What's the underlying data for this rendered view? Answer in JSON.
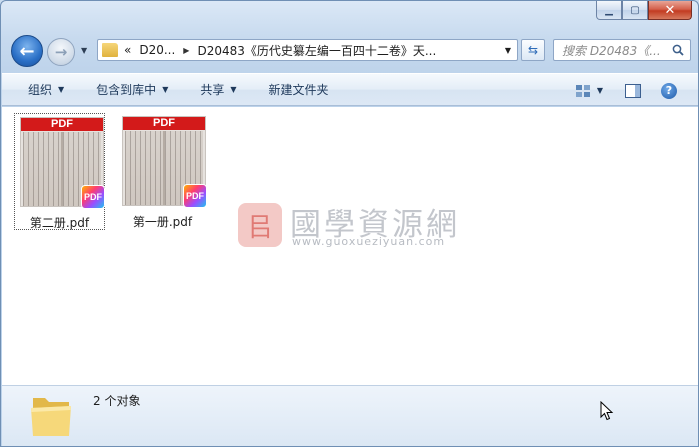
{
  "address": {
    "overflow_chevron": "«",
    "segments": [
      "D20...",
      "D20483《历代史纂左编一百四十二卷》天..."
    ]
  },
  "search": {
    "placeholder": "搜索 D20483《..."
  },
  "toolbar": {
    "organize": "组织",
    "include_in_library": "包含到库中",
    "share": "共享",
    "new_folder": "新建文件夹"
  },
  "files": [
    {
      "name": "第二册.pdf",
      "thumb_label": "PDF",
      "badge": "PDF",
      "selected": true
    },
    {
      "name": "第一册.pdf",
      "thumb_label": "PDF",
      "badge": "PDF",
      "selected": false
    }
  ],
  "watermark": {
    "title": "國學資源網",
    "url": "www.guoxueziyuan.com"
  },
  "status": {
    "item_count": "2 个对象"
  },
  "colors": {
    "pdf_banner": "#d31a1a",
    "window_frame": "#c6d9ee",
    "close_button": "#c23c22"
  }
}
